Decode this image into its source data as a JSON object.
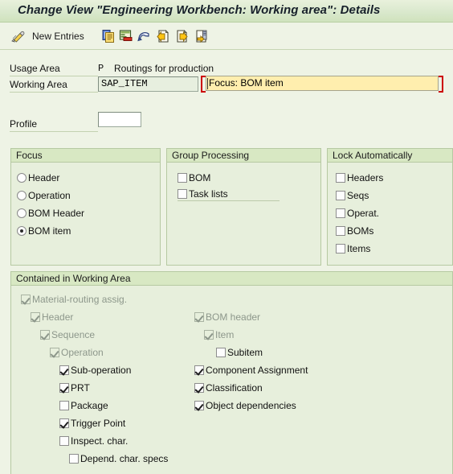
{
  "window": {
    "title": "Change View \"Engineering Workbench: Working area\": Details"
  },
  "toolbar": {
    "pencil_icon": "pencil-icon",
    "new_entries_label": "New Entries",
    "buttons": [
      {
        "icon": "copy-icon",
        "name": "copy-as-button"
      },
      {
        "icon": "details-icon",
        "name": "details-button"
      },
      {
        "icon": "undo-icon",
        "name": "undo-button"
      },
      {
        "icon": "previous-page-icon",
        "name": "previous-entry-button"
      },
      {
        "icon": "next-page-icon",
        "name": "next-entry-button"
      },
      {
        "icon": "variant-icon",
        "name": "other-entry-button"
      }
    ]
  },
  "form": {
    "usage_area_label": "Usage Area",
    "usage_area_key": "P",
    "usage_area_text": "Routings for production",
    "working_area_label": "Working Area",
    "working_area_value": "SAP_ITEM",
    "working_area_desc": "Focus: BOM item",
    "profile_label": "Profile",
    "profile_value": "",
    "profile_placeholder": ""
  },
  "focus_group": {
    "title": "Focus",
    "options": [
      {
        "label": "Header",
        "selected": false
      },
      {
        "label": "Operation",
        "selected": false
      },
      {
        "label": "BOM Header",
        "selected": false
      },
      {
        "label": "BOM item",
        "selected": true
      }
    ]
  },
  "group_processing": {
    "title": "Group Processing",
    "options": [
      {
        "label": "BOM",
        "checked": false
      },
      {
        "label": "Task lists",
        "checked": false
      }
    ]
  },
  "lock_automatically": {
    "title": "Lock Automatically",
    "options": [
      {
        "label": "Headers",
        "checked": false
      },
      {
        "label": "Seqs",
        "checked": false
      },
      {
        "label": "Operat.",
        "checked": false
      },
      {
        "label": "BOMs",
        "checked": false
      },
      {
        "label": "Items",
        "checked": false
      }
    ]
  },
  "contained": {
    "title": "Contained in Working Area",
    "left_tree": [
      {
        "label": "Material-routing assig.",
        "checked": true,
        "disabled": true,
        "indent": 0
      },
      {
        "label": "Header",
        "checked": true,
        "disabled": true,
        "indent": 1
      },
      {
        "label": "Sequence",
        "checked": true,
        "disabled": true,
        "indent": 2
      },
      {
        "label": "Operation",
        "checked": true,
        "disabled": true,
        "indent": 3
      },
      {
        "label": "Sub-operation",
        "checked": true,
        "disabled": false,
        "indent": 4
      },
      {
        "label": "PRT",
        "checked": true,
        "disabled": false,
        "indent": 4
      },
      {
        "label": "Package",
        "checked": false,
        "disabled": false,
        "indent": 4
      },
      {
        "label": "Trigger Point",
        "checked": true,
        "disabled": false,
        "indent": 4
      },
      {
        "label": "Inspect. char.",
        "checked": false,
        "disabled": false,
        "indent": 4
      },
      {
        "label": "Depend. char. specs",
        "checked": false,
        "disabled": false,
        "indent": 5
      }
    ],
    "right_tree": [
      {
        "label": "BOM header",
        "checked": true,
        "disabled": true,
        "indent": 0
      },
      {
        "label": "Item",
        "checked": true,
        "disabled": true,
        "indent": 1
      },
      {
        "label": "Subitem",
        "checked": false,
        "disabled": false,
        "indent": 2
      },
      {
        "label": "Component Assignment",
        "checked": true,
        "disabled": false,
        "indent": 0
      },
      {
        "label": "Classification",
        "checked": true,
        "disabled": false,
        "indent": 0
      },
      {
        "label": "Object dependencies",
        "checked": true,
        "disabled": false,
        "indent": 0
      }
    ]
  },
  "colors": {
    "background": "#eef3e5",
    "group_header": "#d8e8c3",
    "group_body": "#e7efdc",
    "focus_field": "#ffeeae",
    "focus_bracket": "#cc0000",
    "border": "#b6c9a2"
  }
}
